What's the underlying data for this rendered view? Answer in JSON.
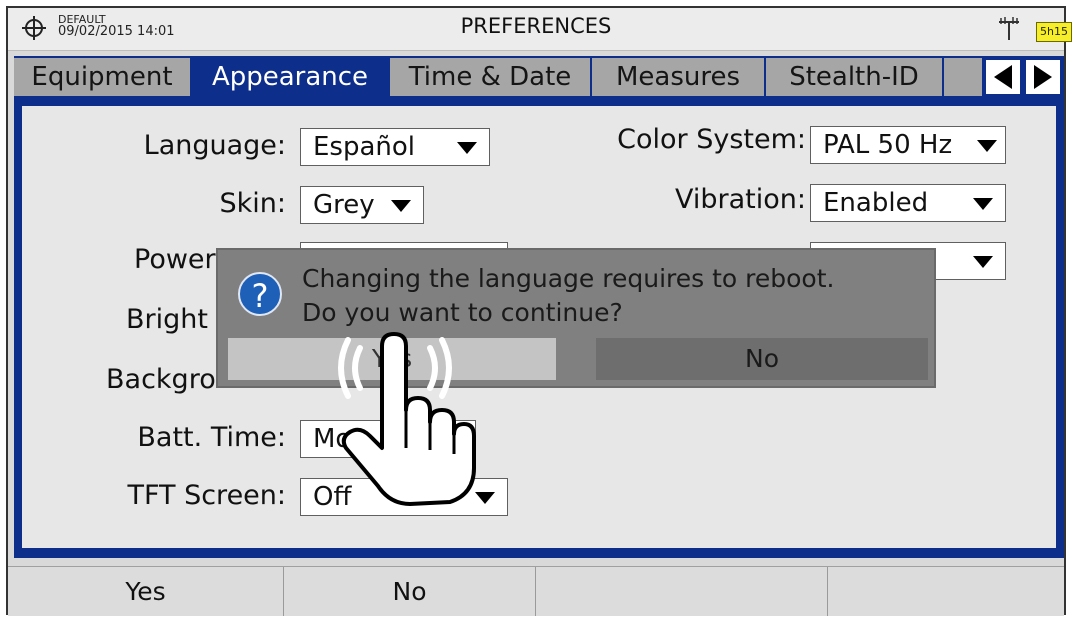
{
  "header": {
    "profile": "DEFAULT",
    "datetime": "09/02/2015 14:01",
    "title": "PREFERENCES",
    "battery": "5h15",
    "battery_color": "#f6ee2a"
  },
  "tabs": [
    {
      "label": "Equipment",
      "active": false
    },
    {
      "label": "Appearance",
      "active": true
    },
    {
      "label": "Time & Date",
      "active": false
    },
    {
      "label": "Measures",
      "active": false
    },
    {
      "label": "Stealth-ID",
      "active": false
    }
  ],
  "nav_icons": [
    "arrow-left-icon",
    "arrow-right-icon"
  ],
  "settings": {
    "language": {
      "label": "Language:",
      "value": "Español"
    },
    "skin": {
      "label": "Skin:",
      "value": "Grey"
    },
    "power_off": {
      "label": "Power"
    },
    "brightness": {
      "label": "Bright"
    },
    "background": {
      "label": "Backgro"
    },
    "batt_time": {
      "label": "Batt. Time:",
      "value": "Mo"
    },
    "tft_screen": {
      "label": "TFT Screen:",
      "value": "Off"
    },
    "color_system": {
      "label": "Color System:",
      "value": "PAL 50 Hz"
    },
    "vibration": {
      "label": "Vibration:",
      "value": "Enabled"
    }
  },
  "dialog": {
    "line1": "Changing the language requires to reboot.",
    "line2": "Do you want to continue?",
    "yes_label": "Yes",
    "no_label": "No"
  },
  "softkeys": [
    "Yes",
    "No",
    "",
    ""
  ],
  "colors": {
    "accent": "#0d2e8a",
    "tab_inactive": "#a6a6a6",
    "dialog_bg": "#808080"
  }
}
